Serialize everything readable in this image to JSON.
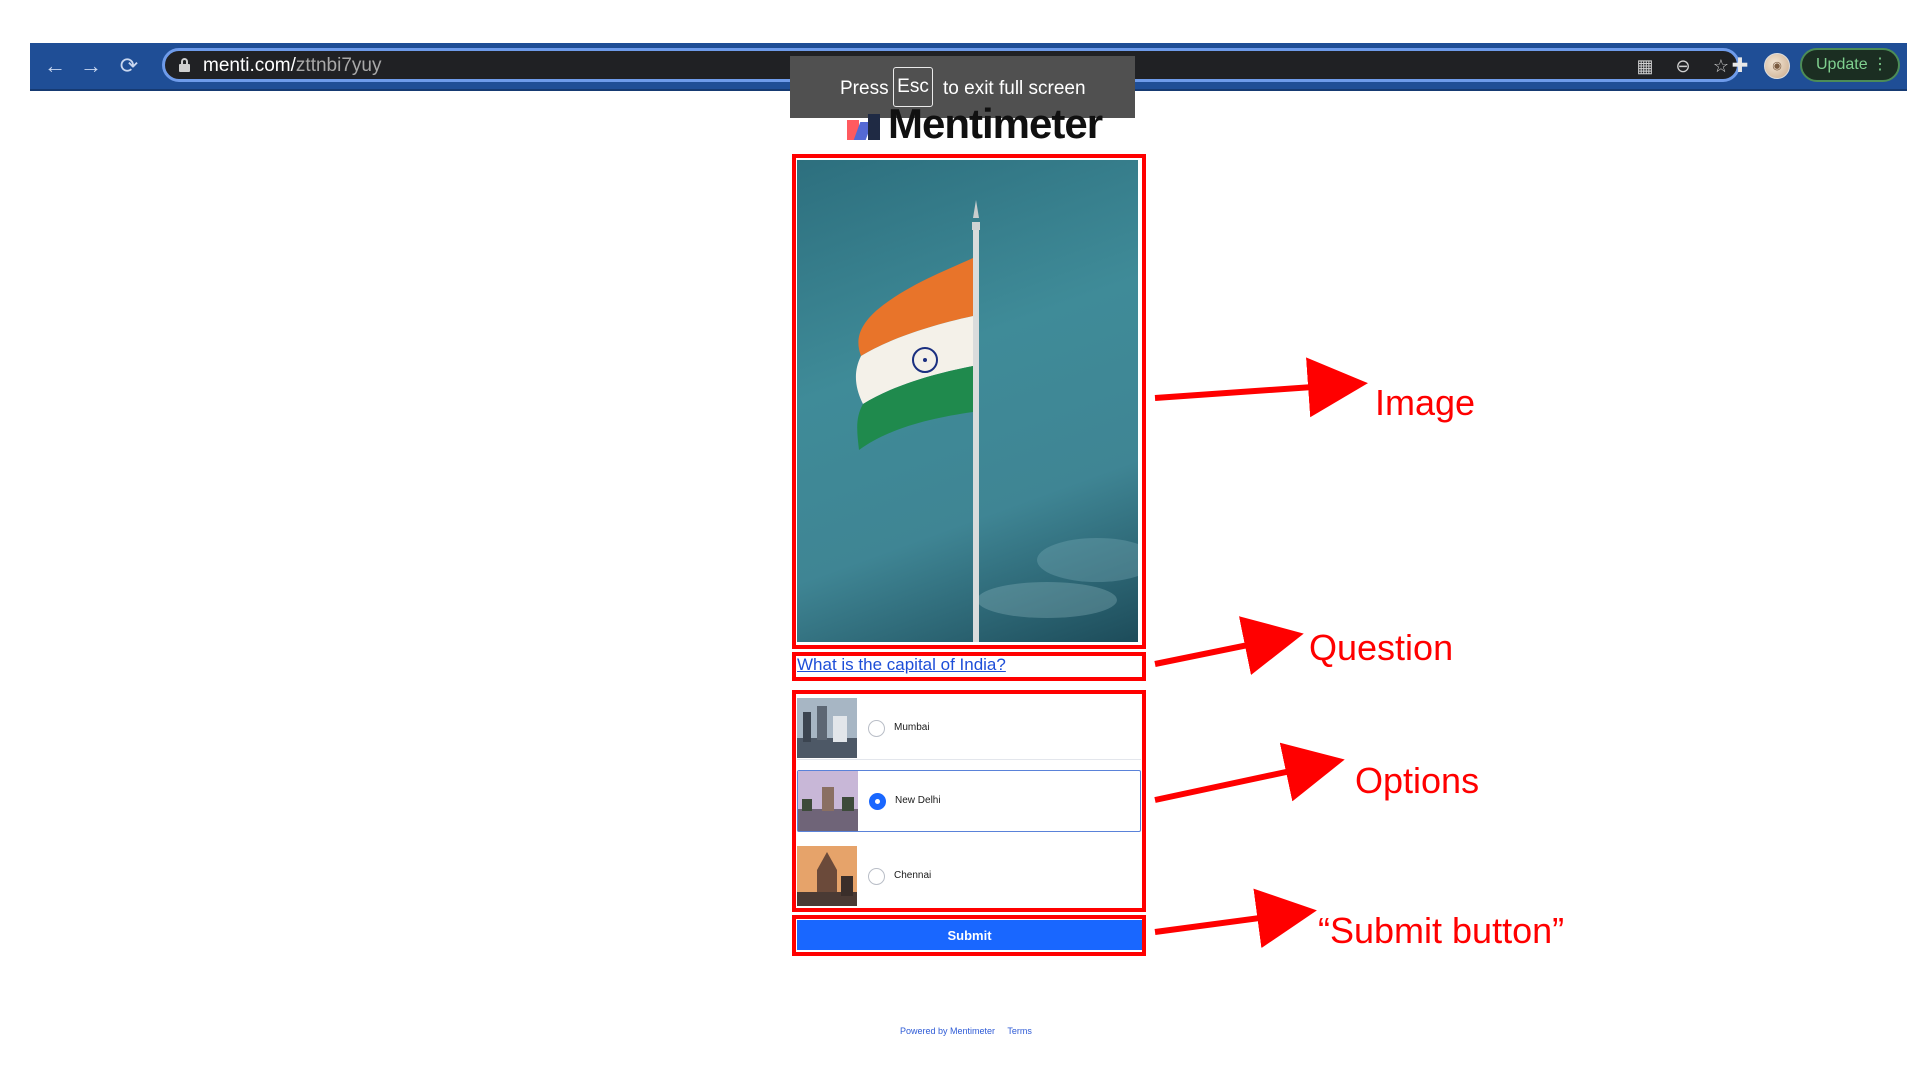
{
  "browser": {
    "url_host": "menti.com/",
    "url_path": "zttnbi7yuy",
    "update_label": "Update",
    "fullscreen_toast": {
      "press": "Press",
      "key": "Esc",
      "rest": "to exit full screen"
    }
  },
  "page": {
    "logo_text": "Mentimeter",
    "question": "What is the capital of India?",
    "options": [
      {
        "label": "Mumbai",
        "selected": false
      },
      {
        "label": "New Delhi",
        "selected": true
      },
      {
        "label": "Chennai",
        "selected": false
      }
    ],
    "submit_label": "Submit",
    "footer": {
      "powered": "Powered by Mentimeter",
      "terms": "Terms"
    }
  },
  "annotations": {
    "image": "Image",
    "question": "Question",
    "options": "Options",
    "submit": "“Submit button”"
  },
  "colors": {
    "annotation": "#ff0000",
    "primary": "#1967ff",
    "chrome": "#1f4e96"
  }
}
